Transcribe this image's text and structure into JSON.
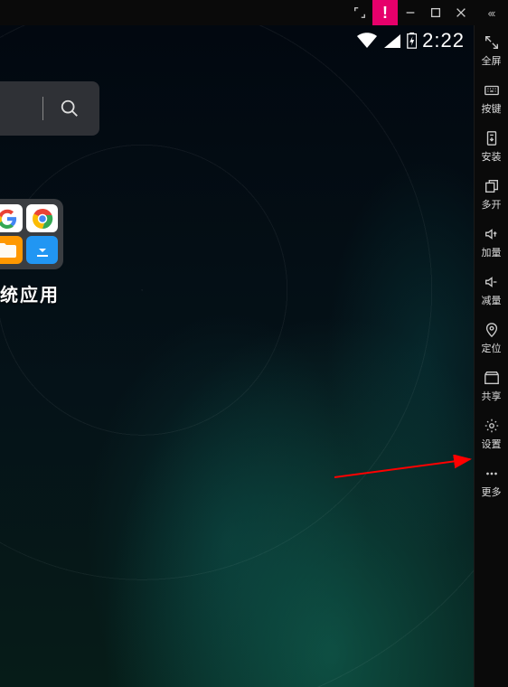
{
  "titlebar": {
    "alert": "!"
  },
  "status": {
    "clock": "2:22"
  },
  "folder_label": "统应用",
  "rail": {
    "items": [
      {
        "id": "fullscreen",
        "label": "全屏"
      },
      {
        "id": "keyboard",
        "label": "按键"
      },
      {
        "id": "install",
        "label": "安装"
      },
      {
        "id": "multi",
        "label": "多开"
      },
      {
        "id": "volup",
        "label": "加量"
      },
      {
        "id": "voldown",
        "label": "减量"
      },
      {
        "id": "locate",
        "label": "定位"
      },
      {
        "id": "share",
        "label": "共享"
      },
      {
        "id": "settings",
        "label": "设置"
      },
      {
        "id": "more",
        "label": "更多"
      }
    ]
  }
}
